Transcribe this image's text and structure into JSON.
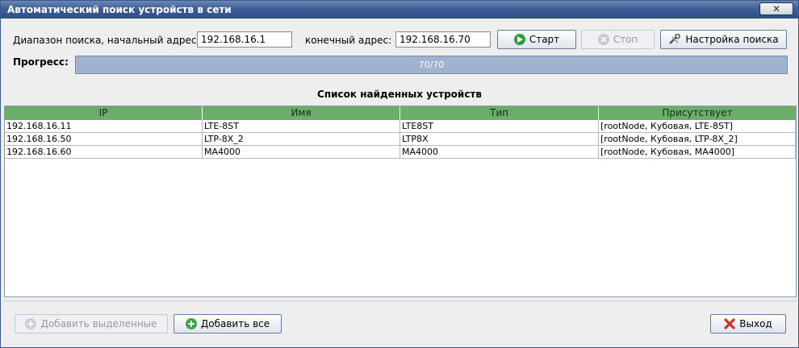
{
  "window": {
    "title": "Автоматический поиск устройств в сети",
    "close": "✕"
  },
  "search": {
    "start_label": "Диапазон поиска, начальный адрес:",
    "start_value": "192.168.16.1",
    "end_label": "конечный адрес:",
    "end_value": "192.168.16.70",
    "start_button": "Старт",
    "stop_button": "Стоп",
    "settings_button": "Настройка поиска"
  },
  "progress": {
    "label": "Прогресс:",
    "text": "70/70",
    "fraction": 1.0
  },
  "devices": {
    "title": "Список найденных устройств",
    "columns": [
      "IP",
      "Имя",
      "Тип",
      "Присутствует"
    ],
    "rows": [
      [
        "192.168.16.11",
        "LTE-8ST",
        "LTE8ST",
        "[rootNode, Кубовая, LTE-8ST]"
      ],
      [
        "192.168.16.50",
        "LTP-8X_2",
        "LTP8X",
        "[rootNode, Кубовая, LTP-8X_2]"
      ],
      [
        "192.168.16.60",
        "MA4000",
        "MA4000",
        "[rootNode, Кубовая, MA4000]"
      ]
    ]
  },
  "footer": {
    "add_selected": "Добавить выделенные",
    "add_all": "Добавить все",
    "exit": "Выход"
  },
  "colors": {
    "header_green": "#6aae6a",
    "progress_fill": "#9fb3ce",
    "title_blue": "#3d5e96"
  }
}
